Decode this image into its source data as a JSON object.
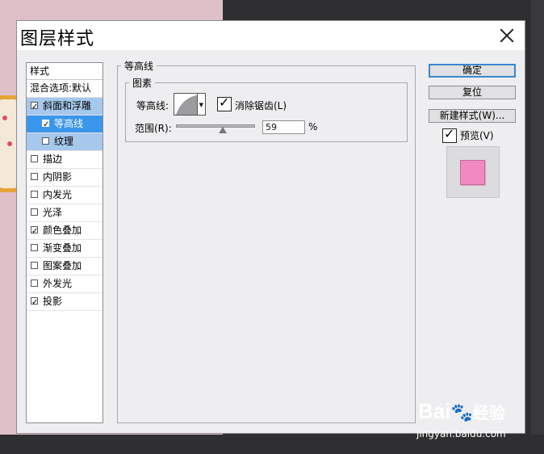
{
  "dialog": {
    "title": "图层样式"
  },
  "style_list": {
    "header": "样式",
    "items": [
      {
        "label": "混合选项:默认",
        "has_checkbox": false,
        "checked": false,
        "state": "normal"
      },
      {
        "label": "斜面和浮雕",
        "has_checkbox": true,
        "checked": true,
        "state": "selected-parent"
      },
      {
        "label": "等高线",
        "has_checkbox": true,
        "checked": true,
        "state": "selected"
      },
      {
        "label": "纹理",
        "has_checkbox": true,
        "checked": false,
        "state": "child"
      },
      {
        "label": "描边",
        "has_checkbox": true,
        "checked": false,
        "state": "normal"
      },
      {
        "label": "内阴影",
        "has_checkbox": true,
        "checked": false,
        "state": "normal"
      },
      {
        "label": "内发光",
        "has_checkbox": true,
        "checked": false,
        "state": "normal"
      },
      {
        "label": "光泽",
        "has_checkbox": true,
        "checked": false,
        "state": "normal"
      },
      {
        "label": "颜色叠加",
        "has_checkbox": true,
        "checked": true,
        "state": "normal"
      },
      {
        "label": "渐变叠加",
        "has_checkbox": true,
        "checked": false,
        "state": "normal"
      },
      {
        "label": "图案叠加",
        "has_checkbox": true,
        "checked": false,
        "state": "normal"
      },
      {
        "label": "外发光",
        "has_checkbox": true,
        "checked": false,
        "state": "normal"
      },
      {
        "label": "投影",
        "has_checkbox": true,
        "checked": true,
        "state": "normal"
      }
    ]
  },
  "panel": {
    "section_title": "等高线",
    "group_title": "图素",
    "contour_label": "等高线:",
    "antialias_label": "消除锯齿(L)",
    "antialias_checked": true,
    "range_label": "范围(R):",
    "range_value": "59",
    "range_unit": "%"
  },
  "buttons": {
    "ok": "确定",
    "reset": "复位",
    "new_style": "新建样式(W)...",
    "preview_label": "预览(V)",
    "preview_checked": true
  },
  "colors": {
    "accent": "#3a96ed",
    "selection_light": "#a6c8ec",
    "preview_swatch": "#f28ac1"
  },
  "watermark": {
    "brand": "Bai",
    "brand_suffix": "经验",
    "url": "jingyan.baidu.com"
  }
}
